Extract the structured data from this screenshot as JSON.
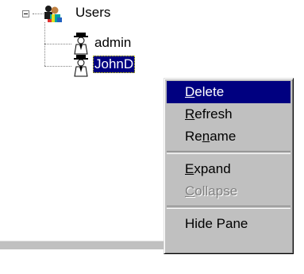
{
  "tree": {
    "root": {
      "label": "Users",
      "icon": "users-group-icon",
      "expanded": true
    },
    "children": [
      {
        "label": "admin",
        "icon": "user-icon",
        "selected": false
      },
      {
        "label": "JohnD",
        "icon": "user-icon",
        "selected": true
      }
    ]
  },
  "context_menu": {
    "items": [
      {
        "label": "Delete",
        "mnemonic_index": 0,
        "highlighted": true,
        "disabled": false
      },
      {
        "label": "Refresh",
        "mnemonic_index": 0,
        "highlighted": false,
        "disabled": false
      },
      {
        "label": "Rename",
        "mnemonic_index": 2,
        "highlighted": false,
        "disabled": false
      },
      {
        "label": "Expand",
        "mnemonic_index": 0,
        "highlighted": false,
        "disabled": false
      },
      {
        "label": "Collapse",
        "mnemonic_index": 0,
        "highlighted": false,
        "disabled": true
      },
      {
        "label": "Hide Pane",
        "highlighted": false,
        "disabled": false
      }
    ]
  },
  "colors": {
    "selection": "#000080",
    "menu_face": "#c0c0c0",
    "disabled_text": "#808080"
  }
}
